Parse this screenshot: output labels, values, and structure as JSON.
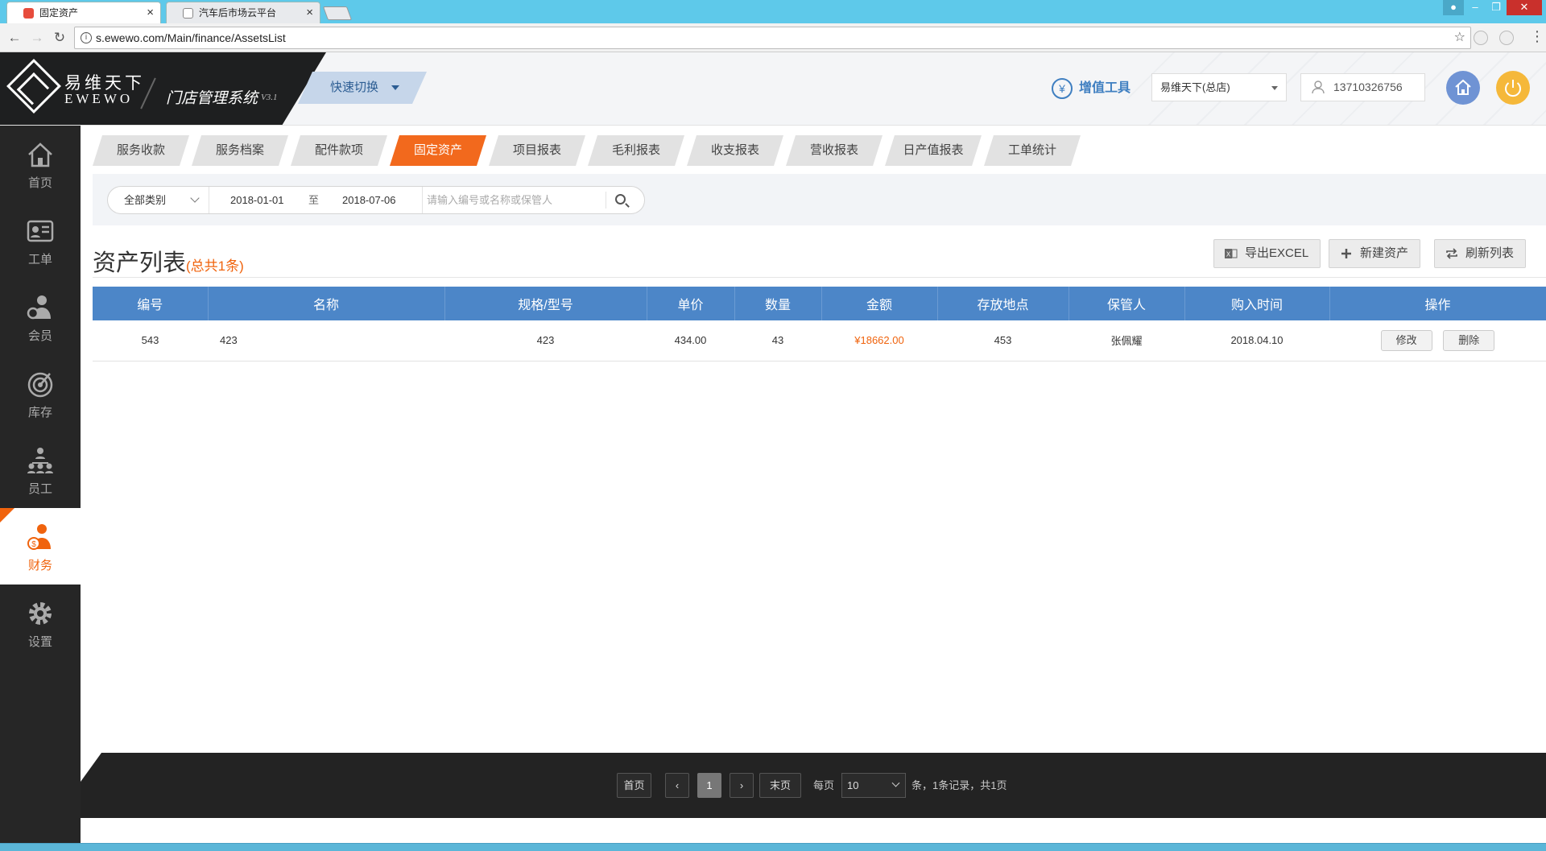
{
  "browser": {
    "tabs": [
      {
        "title": "固定资产",
        "active": true
      },
      {
        "title": "汽车后市场云平台",
        "active": false
      }
    ],
    "url": "s.ewewo.com/Main/finance/AssetsList"
  },
  "brand": {
    "name_cn": "易维天下",
    "name_en": "EWEWO",
    "system": "门店管理系统",
    "version": "V3.1"
  },
  "header": {
    "quick_switch": "快速切换",
    "tools": "增值工具",
    "store": "易维天下(总店)",
    "user_phone": "13710326756"
  },
  "sidebar": {
    "items": [
      {
        "label": "首页",
        "icon": "home-icon"
      },
      {
        "label": "工单",
        "icon": "work-order-icon"
      },
      {
        "label": "会员",
        "icon": "member-icon"
      },
      {
        "label": "库存",
        "icon": "inventory-icon"
      },
      {
        "label": "员工",
        "icon": "staff-icon"
      },
      {
        "label": "财务",
        "icon": "finance-icon",
        "active": true
      },
      {
        "label": "设置",
        "icon": "settings-icon"
      }
    ]
  },
  "nav_tabs": [
    "服务收款",
    "服务档案",
    "配件款项",
    "固定资产",
    "项目报表",
    "毛利报表",
    "收支报表",
    "营收报表",
    "日产值报表",
    "工单统计"
  ],
  "nav_active_index": 3,
  "filter": {
    "category": "全部类别",
    "date_from": "2018-01-01",
    "date_sep": "至",
    "date_to": "2018-07-06",
    "search_placeholder": "请输入编号或名称或保管人"
  },
  "list": {
    "title": "资产列表",
    "count_text": "(总共1条)",
    "actions": {
      "export": "导出EXCEL",
      "create": "新建资产",
      "refresh": "刷新列表"
    },
    "columns": [
      "编号",
      "名称",
      "规格/型号",
      "单价",
      "数量",
      "金额",
      "存放地点",
      "保管人",
      "购入时间",
      "操作"
    ],
    "rows": [
      {
        "id": "543",
        "name": "423",
        "spec": "423",
        "price": "434.00",
        "qty": "43",
        "amount": "¥18662.00",
        "location": "453",
        "keeper": "张佩耀",
        "date": "2018.04.10",
        "edit": "修改",
        "delete": "删除"
      }
    ]
  },
  "pagination": {
    "first": "首页",
    "prev": "‹",
    "current": "1",
    "next": "›",
    "last": "末页",
    "per_page_label": "每页",
    "per_page": "10",
    "summary": "条，1条记录，共1页"
  },
  "colors": {
    "accent": "#f0630d",
    "table_header": "#4c86c8",
    "sidebar": "#262626"
  }
}
